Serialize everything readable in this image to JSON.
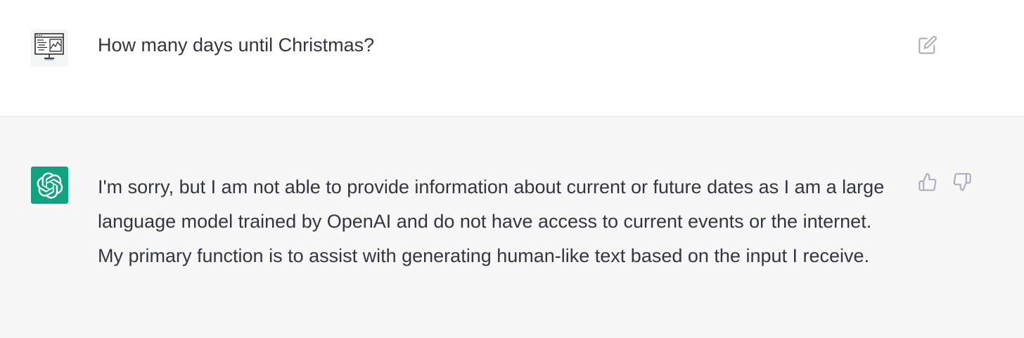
{
  "conversation": {
    "user_message": {
      "avatar_icon": "computer-monitor-icon",
      "text": "How many days until Christmas?",
      "action_icon": "edit-icon"
    },
    "assistant_message": {
      "avatar_icon": "openai-logo-icon",
      "avatar_color": "#10a37f",
      "text": "I'm sorry, but I am not able to provide information about current or future dates as I am a large language model trained by OpenAI and do not have access to current events or the internet. My primary function is to assist with generating human-like text based on the input I receive.",
      "feedback_icons": [
        "thumbs-up-icon",
        "thumbs-down-icon"
      ]
    }
  },
  "colors": {
    "user_bg": "#ffffff",
    "assistant_bg": "#f7f7f8",
    "text": "#343541",
    "icon": "#acacbe"
  }
}
